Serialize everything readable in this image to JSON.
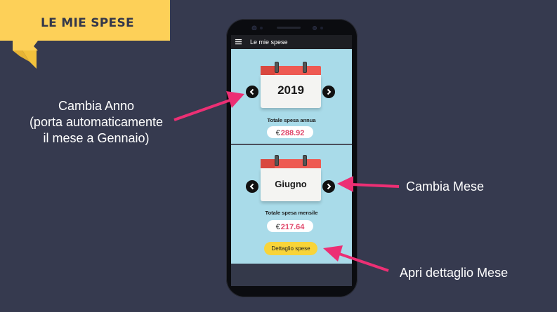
{
  "banner": {
    "title": "LE MIE SPESE"
  },
  "annotations": {
    "change_year": [
      "Cambia Anno",
      "(porta automaticamente",
      "il mese a Gennaio)"
    ],
    "change_month": "Cambia Mese",
    "open_detail": "Apri dettaglio Mese"
  },
  "app": {
    "title": "Le mie spese",
    "menu_icon": "hamburger-icon",
    "year_section": {
      "year": "2019",
      "label": "Totale spesa annua",
      "currency": "€",
      "amount": "288.92"
    },
    "month_section": {
      "month": "Giugno",
      "label": "Totale spesa mensile",
      "currency": "€",
      "amount": "217.64"
    },
    "detail_button": "Dettaglio spese"
  },
  "colors": {
    "background": "#363a4f",
    "banner": "#fdd058",
    "screen": "#a9dbe9",
    "arrow": "#ec2f74",
    "amount": "#e0466a",
    "calendar_header": "#ee5a52",
    "detail_button": "#f8d439"
  }
}
